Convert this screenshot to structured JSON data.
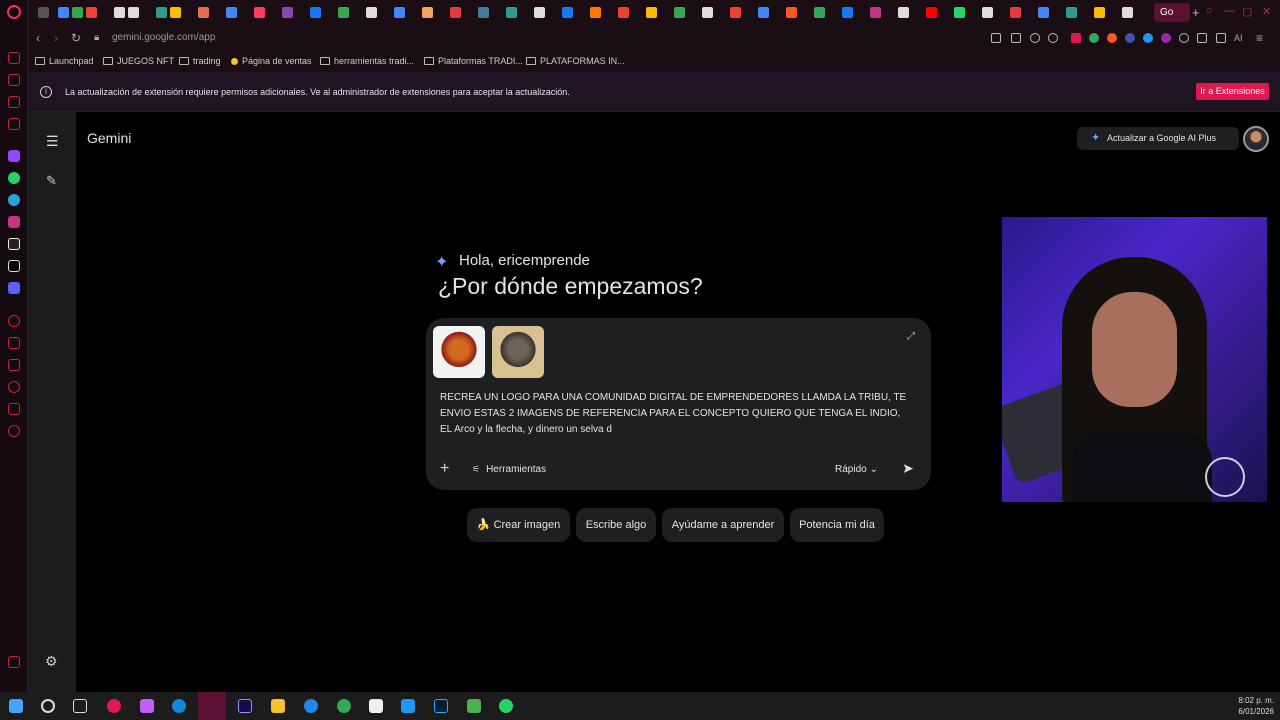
{
  "browser": {
    "active_tab": "Go",
    "url": "gemini.google.com/app",
    "address_ext_label": "AI",
    "bookmarks": [
      "Launchpad",
      "JUEGOS NFT",
      "trading",
      "Página de ventas",
      "herramientas tradi...",
      "Plataformas TRADI...",
      "PLATAFORMAS IN..."
    ]
  },
  "notice": {
    "text": "La actualización de extensión requiere permisos adicionales. Ve al administrador de extensiones para aceptar la actualización.",
    "button": "Ir a Extensiones"
  },
  "gemini": {
    "title": "Gemini",
    "upgrade_label": "Actualizar a Google AI Plus",
    "greeting_small": "Hola, ericemprende",
    "greeting_big": "¿Por dónde empezamos?",
    "prompt": "RECREA UN LOGO PARA UNA COMUNIDAD DIGITAL DE EMPRENDEDORES LLAMDA LA TRIBU, TE ENVIO ESTAS 2 IMAGENS DE REFERENCIA PARA EL CONCEPTO QUIERO QUE TENGA EL INDIO, EL Arco y la flecha, y dinero un selva d",
    "tools_label": "Herramientas",
    "model_label": "Rápido",
    "chips": [
      "Crear imagen",
      "Escribe algo",
      "Ayúdame a aprender",
      "Potencia mi día"
    ],
    "chip_icon_0": "🍌"
  },
  "taskbar": {
    "time": "8:02 p. m.",
    "date": "6/01/2026"
  },
  "colors": {
    "accent": "#e01850",
    "gemini_blue": "#6aa4ff",
    "composer_bg": "#1e1f20"
  }
}
